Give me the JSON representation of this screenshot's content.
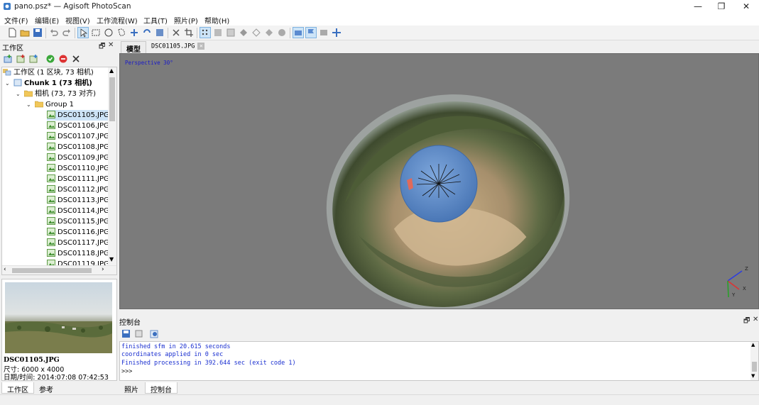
{
  "window": {
    "title": "pano.psz* — Agisoft PhotoScan",
    "minimize": "—",
    "maximize": "❐",
    "close": "✕"
  },
  "menu": [
    "文件(F)",
    "编辑(E)",
    "视图(V)",
    "工作流程(W)",
    "工具(T)",
    "照片(P)",
    "帮助(H)"
  ],
  "workspace": {
    "title": "工作区",
    "float_icon": "🗗",
    "close_icon": "✕",
    "tree_root": "工作区 (1 区块, 73 相机)",
    "chunk": "Chunk 1 (73 相机)",
    "cameras_folder": "相机 (73, 73 对齐)",
    "group": "Group 1",
    "images": [
      "DSC01105.JPG",
      "DSC01106.JPG",
      "DSC01107.JPG",
      "DSC01108.JPG",
      "DSC01109.JPG",
      "DSC01110.JPG",
      "DSC01111.JPG",
      "DSC01112.JPG",
      "DSC01113.JPG",
      "DSC01114.JPG",
      "DSC01115.JPG",
      "DSC01116.JPG",
      "DSC01117.JPG",
      "DSC01118.JPG",
      "DSC01119.JPG"
    ],
    "selected_image": "DSC01105.JPG"
  },
  "photo_info": {
    "filename": "DSC01105.JPG",
    "size": "尺寸: 6000 x 4000",
    "datetime": "日期/时间: 2014:07:08 07:42:53"
  },
  "left_tabs": [
    "工作区",
    "参考"
  ],
  "doc_tabs": {
    "model": "模型",
    "photo": "DSC01105.JPG"
  },
  "viewport": {
    "projection_label": "Perspective 30°",
    "axis_labels": {
      "z": "Z",
      "x": "X",
      "y": "Y"
    }
  },
  "console": {
    "title": "控制台",
    "lines": [
      "finished sfm in 20.615 seconds",
      "coordinates applied in 0 sec",
      "Finished processing in 392.644 sec (exit code 1)"
    ],
    "prompt": ">>>"
  },
  "bottom_tabs": [
    "照片",
    "控制台"
  ],
  "colors": {
    "console_text": "#1a2fd0",
    "viewport_bg": "#7b7b7b",
    "selection": "#cde4f7"
  }
}
